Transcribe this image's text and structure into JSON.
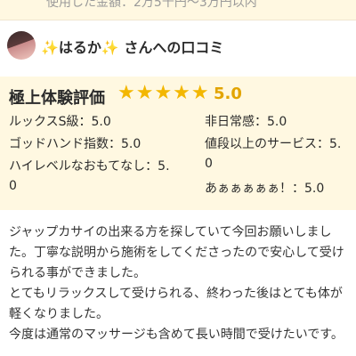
{
  "header": {
    "used_amount": "使用した金額：2万5千円〜3万円以内"
  },
  "reviewer": {
    "title": "✨はるか✨ さんへの口コミ"
  },
  "evaluation": {
    "heading": "極上体験評価",
    "stars": "★★★★★",
    "rating": 5.0,
    "score": "5.0",
    "star_color": "#f3b700",
    "metrics": [
      {
        "line1": "ルックスS級：5.0"
      },
      {
        "line1": "非日常感：5.0"
      },
      {
        "line1": "ゴッドハンド指数：5.0"
      },
      {
        "line1": "値段以上のサービス：5.",
        "line2": "0"
      },
      {
        "line1": "ハイレベルなおもてなし：5.",
        "line2": "0"
      },
      {
        "line1": "あぁぁぁぁぁ！：5.0"
      }
    ]
  },
  "review": {
    "paragraphs": [
      "ジャップカサイの出来る方を探していて今回お願いしました。丁寧な説明から施術をしてくださったので安心して受けられる事ができました。",
      "とてもリラックスして受けられる、終わった後はとても体が軽くなりました。",
      "今度は通常のマッサージも含めて長い時間で受けたいです。"
    ]
  }
}
